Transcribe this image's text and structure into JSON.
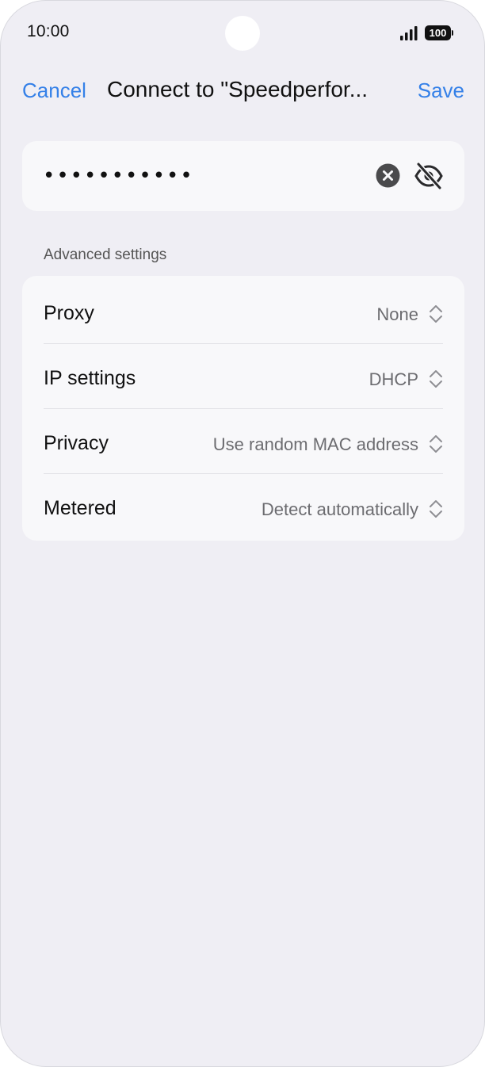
{
  "status_bar": {
    "time": "10:00",
    "battery": "100",
    "icons": [
      "signal-icon",
      "battery-icon"
    ]
  },
  "header": {
    "cancel_label": "Cancel",
    "title": "Connect to \"Speedperfor...",
    "save_label": "Save"
  },
  "password": {
    "value": "•••••••••••",
    "icons": [
      "clear-icon",
      "hide-password-icon"
    ]
  },
  "advanced": {
    "section_label": "Advanced settings",
    "rows": [
      {
        "label": "Proxy",
        "value": "None"
      },
      {
        "label": "IP settings",
        "value": "DHCP"
      },
      {
        "label": "Privacy",
        "value": "Use random MAC address"
      },
      {
        "label": "Metered",
        "value": "Detect automatically"
      }
    ]
  },
  "colors": {
    "accent": "#3480e8",
    "background": "#efeef4",
    "card": "#f8f8fa"
  }
}
